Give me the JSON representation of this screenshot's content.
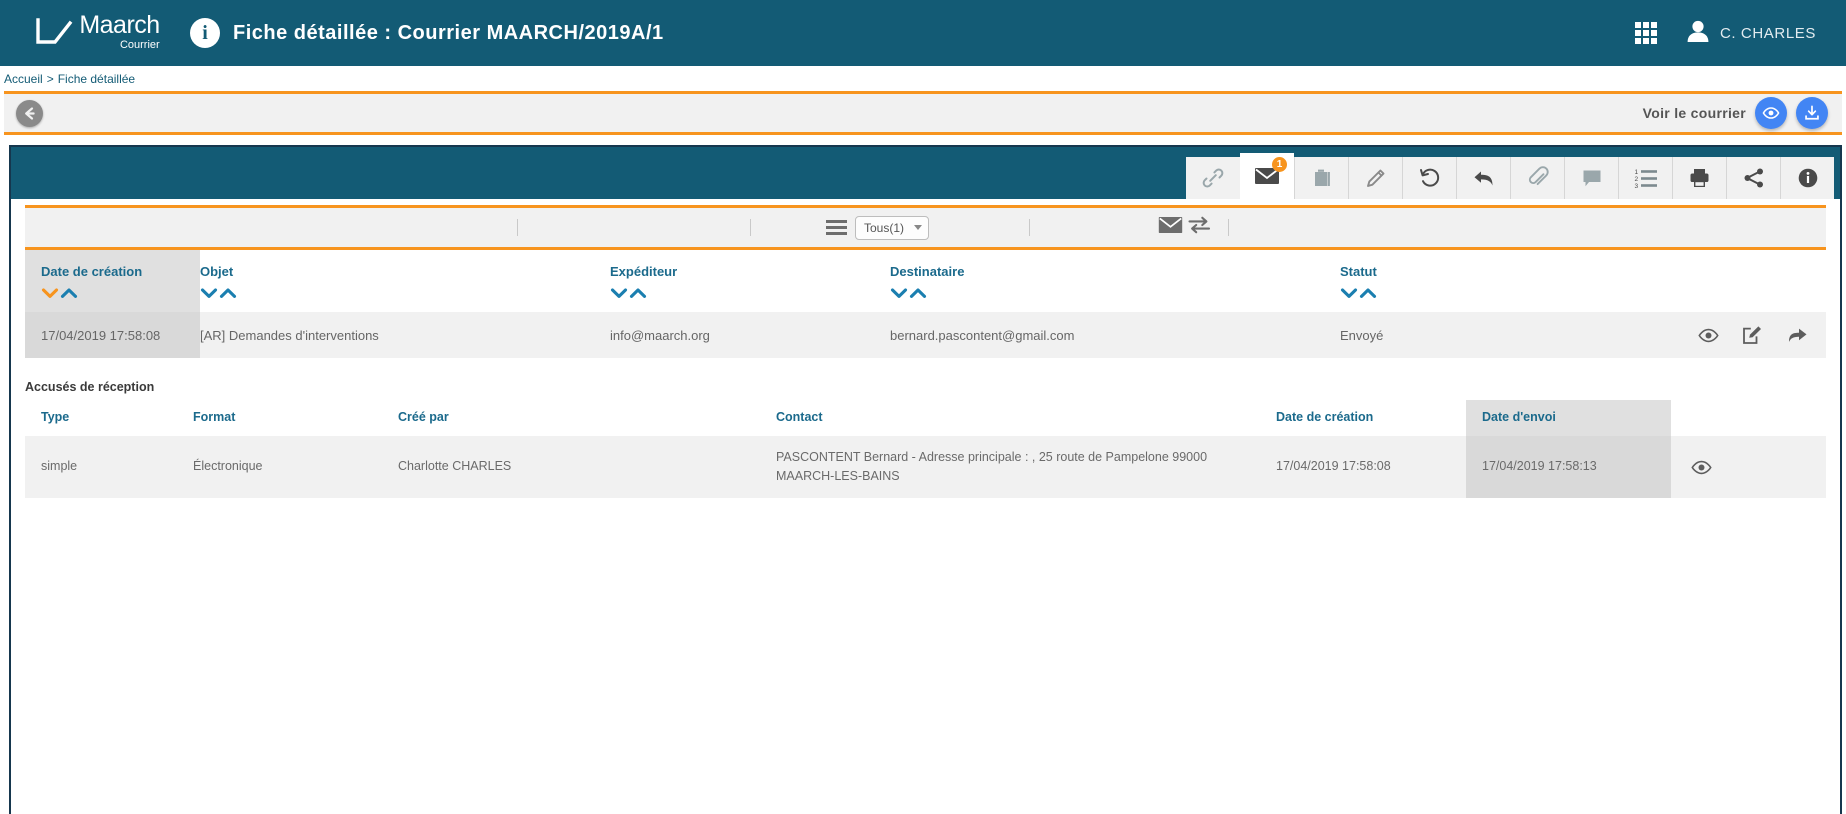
{
  "header": {
    "logo_main": "Maarch",
    "logo_sub": "Courrier",
    "info_icon": "info-icon",
    "title": "Fiche détaillée : Courrier MAARCH/2019A/1",
    "apps_icon": "apps-grid-icon",
    "user_icon": "user-avatar-icon",
    "user_name": "C. CHARLES"
  },
  "breadcrumb": {
    "home": "Accueil",
    "separator": ">",
    "current": "Fiche détaillée"
  },
  "action_bar": {
    "back_icon": "arrow-left-circle-icon",
    "view_label": "Voir le courrier",
    "eye_icon": "eye-icon",
    "download_icon": "download-icon"
  },
  "tabs": [
    {
      "name": "tab-links",
      "icon": "link-icon",
      "active": false,
      "badge": ""
    },
    {
      "name": "tab-mail",
      "icon": "envelope-icon",
      "active": true,
      "badge": "1"
    },
    {
      "name": "tab-archive",
      "icon": "briefcase-icon",
      "active": false,
      "badge": ""
    },
    {
      "name": "tab-edit",
      "icon": "pencil-icon",
      "active": false,
      "badge": ""
    },
    {
      "name": "tab-history",
      "icon": "history-icon",
      "active": false,
      "badge": ""
    },
    {
      "name": "tab-reply",
      "icon": "reply-arrow-icon",
      "active": false,
      "badge": ""
    },
    {
      "name": "tab-attachments",
      "icon": "paperclip-icon",
      "active": false,
      "badge": ""
    },
    {
      "name": "tab-notes",
      "icon": "comment-icon",
      "active": false,
      "badge": ""
    },
    {
      "name": "tab-list",
      "icon": "numbered-list-icon",
      "active": false,
      "badge": ""
    },
    {
      "name": "tab-print",
      "icon": "printer-icon",
      "active": false,
      "badge": ""
    },
    {
      "name": "tab-share",
      "icon": "share-icon",
      "active": false,
      "badge": ""
    },
    {
      "name": "tab-info",
      "icon": "info-circle-icon",
      "active": false,
      "badge": ""
    }
  ],
  "filter_bar": {
    "menu_icon": "hamburger-icon",
    "select_value": "Tous(1)",
    "envelope_icon": "envelope-icon",
    "exchange_icon": "exchange-arrows-icon"
  },
  "mail_table": {
    "columns": [
      {
        "label": "Date de création",
        "sorted": true
      },
      {
        "label": "Objet",
        "sorted": false
      },
      {
        "label": "Expéditeur",
        "sorted": false
      },
      {
        "label": "Destinataire",
        "sorted": false
      },
      {
        "label": "Statut",
        "sorted": false
      },
      {
        "label": "",
        "sorted": false
      }
    ],
    "rows": [
      {
        "date_creation": "17/04/2019 17:58:08",
        "objet": "[AR] Demandes d'interventions",
        "expediteur": "info@maarch.org",
        "destinataire": "bernard.pascontent@gmail.com",
        "statut": "Envoyé",
        "actions": [
          "eye-icon",
          "edit-square-icon",
          "forward-arrow-icon"
        ]
      }
    ]
  },
  "receipts_section": {
    "title": "Accusés de réception",
    "columns": [
      {
        "label": "Type",
        "sorted": false
      },
      {
        "label": "Format",
        "sorted": false
      },
      {
        "label": "Créé par",
        "sorted": false
      },
      {
        "label": "Contact",
        "sorted": false
      },
      {
        "label": "Date de création",
        "sorted": false
      },
      {
        "label": "Date d'envoi",
        "sorted": true
      },
      {
        "label": "",
        "sorted": false
      }
    ],
    "rows": [
      {
        "type": "simple",
        "format": "Électronique",
        "cree_par": "Charlotte CHARLES",
        "contact": "PASCONTENT Bernard - Adresse principale : , 25 route de Pampelone 99000 MAARCH-LES-BAINS",
        "date_creation": "17/04/2019 17:58:08",
        "date_envoi": "17/04/2019 17:58:13",
        "actions": [
          "eye-icon"
        ]
      }
    ]
  },
  "colors": {
    "brand_teal": "#135b75",
    "accent_orange": "#f7941e",
    "link_blue": "#1b6a8c",
    "button_blue": "#4285f4",
    "panel_border": "#16374e"
  }
}
